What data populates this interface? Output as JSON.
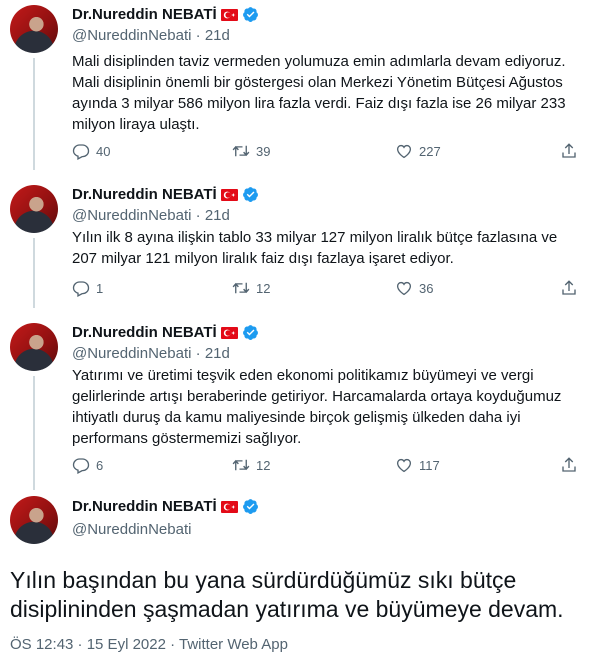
{
  "tweets": [
    {
      "name": "Dr.Nureddin NEBATİ",
      "handle": "@NureddinNebati",
      "sep": "·",
      "time": "21d",
      "text": "Mali disiplinden taviz vermeden yolumuza emin adımlarla devam ediyoruz. Mali disiplinin önemli bir göstergesi olan Merkezi Yönetim Bütçesi Ağustos ayında 3 milyar 586 milyon lira fazla verdi. Faiz dışı fazla ise 26 milyar 233 milyon liraya ulaştı.",
      "replies": "40",
      "retweets": "39",
      "likes": "227"
    },
    {
      "name": "Dr.Nureddin NEBATİ",
      "handle": "@NureddinNebati",
      "sep": "·",
      "time": "21d",
      "text": "Yılın ilk 8 ayına ilişkin tablo 33 milyar 127 milyon liralık bütçe fazlasına ve 207 milyar 121 milyon liralık faiz dışı fazlaya işaret ediyor.",
      "replies": "1",
      "retweets": "12",
      "likes": "36"
    },
    {
      "name": "Dr.Nureddin NEBATİ",
      "handle": "@NureddinNebati",
      "sep": "·",
      "time": "21d",
      "text": "Yatırımı ve üretimi teşvik eden ekonomi politikamız büyümeyi ve vergi gelirlerinde artışı beraberinde getiriyor. Harcamalarda ortaya koyduğumuz ihtiyatlı duruş da kamu maliyesinde birçok gelişmiş ülkeden daha iyi performans göstermemizi sağlıyor.",
      "replies": "6",
      "retweets": "12",
      "likes": "117"
    }
  ],
  "main_tweet": {
    "name": "Dr.Nureddin NEBATİ",
    "handle": "@NureddinNebati",
    "text": "Yılın başından bu yana sürdürdüğümüz sıkı bütçe disiplininden şaşmadan yatırıma ve büyümeye devam.",
    "meta": "ÖS 12:43 · 15 Eyl 2022 · Twitter Web App"
  },
  "colors": {
    "verified": "#1d9bf0",
    "secondary_text": "#536471",
    "flag_red": "#e30a17"
  },
  "icons": [
    "reply-icon",
    "retweet-icon",
    "like-icon",
    "share-icon",
    "verified-icon",
    "turkish-flag-icon"
  ]
}
